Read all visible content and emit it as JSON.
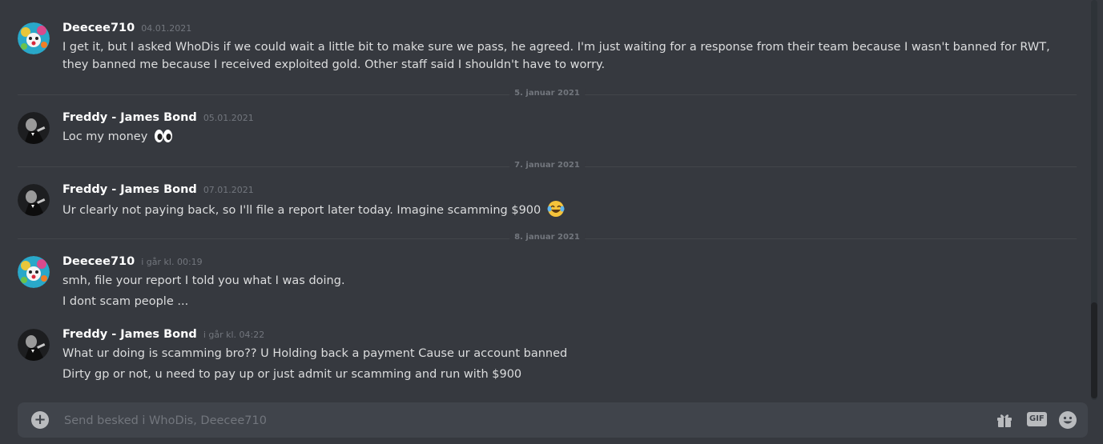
{
  "messages": [
    {
      "username": "Deecee710",
      "timestamp": "04.01.2021",
      "avatar": "deecee-avatar",
      "lines": [
        "I get it, but I asked WhoDis if we could wait a little bit to make sure we pass, he agreed. I'm just waiting for a response from their team because I wasn't banned for RWT, they banned me because I received exploited gold. Other staff said I shouldn't have to worry."
      ]
    },
    {
      "divider": "5. januar 2021",
      "username": "Freddy - James Bond",
      "timestamp": "05.01.2021",
      "avatar": "freddy-avatar",
      "lines": [
        "Loc my money"
      ],
      "emoji": "eyes"
    },
    {
      "divider": "7. januar 2021",
      "username": "Freddy - James Bond",
      "timestamp": "07.01.2021",
      "avatar": "freddy-avatar",
      "lines": [
        "Ur clearly not paying back, so I'll file a report later today. Imagine scamming $900"
      ],
      "emoji": "joy"
    },
    {
      "divider": "8. januar 2021",
      "username": "Deecee710",
      "timestamp": "i går kl. 00:19",
      "avatar": "deecee-avatar",
      "lines": [
        "smh, file your report I told you what I was doing.",
        "I dont scam people ..."
      ]
    },
    {
      "username": "Freddy - James Bond",
      "timestamp": "i går kl. 04:22",
      "avatar": "freddy-avatar",
      "lines": [
        "What ur doing is scamming bro?? U Holding back a payment Cause ur account banned",
        "Dirty gp or not, u need to pay up or just admit ur scamming and run with $900"
      ]
    }
  ],
  "composer": {
    "placeholder": "Send besked i WhoDis, Deecee710",
    "add_icon": "plus-circle-icon",
    "gift_icon": "gift-icon",
    "gif_label": "GIF",
    "emoji_icon": "smile-icon"
  },
  "colors": {
    "background": "#36393f",
    "composer": "#40444b",
    "username": "#ffffff",
    "timestamp": "#72767d"
  }
}
